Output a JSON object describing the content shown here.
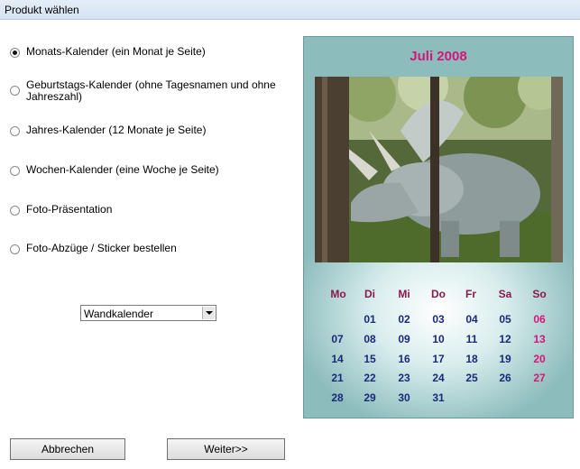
{
  "window": {
    "title": "Produkt wählen"
  },
  "options": [
    {
      "label": "Monats-Kalender (ein Monat je Seite)",
      "checked": true
    },
    {
      "label": "Geburtstags-Kalender (ohne Tagesnamen und ohne Jahreszahl)",
      "checked": false
    },
    {
      "label": "Jahres-Kalender (12 Monate je Seite)",
      "checked": false
    },
    {
      "label": "Wochen-Kalender (eine Woche je Seite)",
      "checked": false
    },
    {
      "label": "Foto-Präsentation",
      "checked": false
    },
    {
      "label": "Foto-Abzüge / Sticker bestellen",
      "checked": false
    }
  ],
  "format_select": {
    "value": "Wandkalender"
  },
  "preview": {
    "title": "Juli 2008",
    "weekdays": [
      "Mo",
      "Di",
      "Mi",
      "Do",
      "Fr",
      "Sa",
      "So"
    ],
    "weeks": [
      [
        "",
        "01",
        "02",
        "03",
        "04",
        "05",
        "06"
      ],
      [
        "07",
        "08",
        "09",
        "10",
        "11",
        "12",
        "13"
      ],
      [
        "14",
        "15",
        "16",
        "17",
        "18",
        "19",
        "20"
      ],
      [
        "21",
        "22",
        "23",
        "24",
        "25",
        "26",
        "27"
      ],
      [
        "28",
        "29",
        "30",
        "31",
        "",
        "",
        ""
      ]
    ],
    "colors": {
      "title": "#d6157a",
      "weekday": "#8a1a4e",
      "day": "#1a2a7a",
      "sunday": "#d6157a"
    }
  },
  "buttons": {
    "cancel": "Abbrechen",
    "next": "Weiter>>"
  }
}
